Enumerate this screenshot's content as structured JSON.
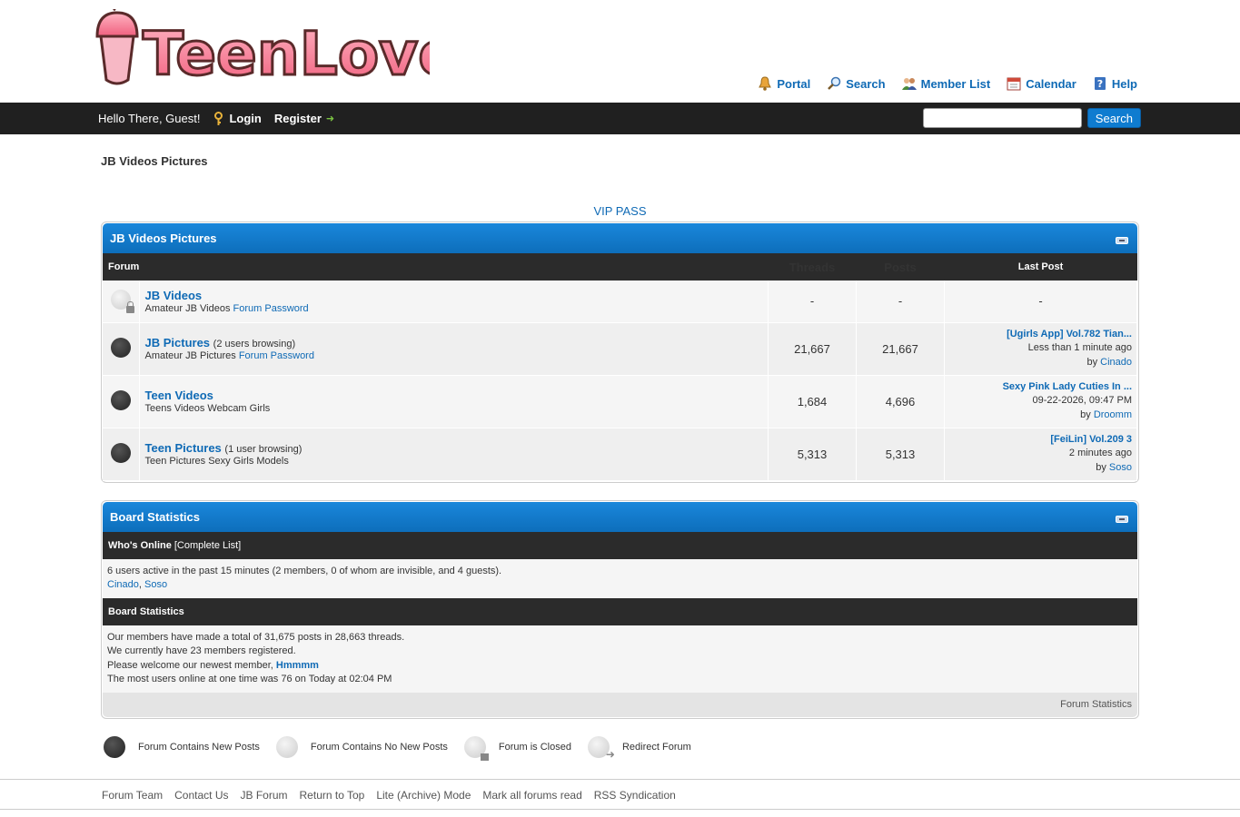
{
  "logo_text": "TeenLover",
  "toplinks": [
    {
      "label": "Portal",
      "icon": "bell-icon"
    },
    {
      "label": "Search",
      "icon": "search-icon"
    },
    {
      "label": "Member List",
      "icon": "members-icon"
    },
    {
      "label": "Calendar",
      "icon": "calendar-icon"
    },
    {
      "label": "Help",
      "icon": "help-icon"
    }
  ],
  "panel": {
    "greeting": "Hello There, Guest!",
    "login": "Login",
    "register": "Register",
    "search_button": "Search",
    "search_value": ""
  },
  "breadcrumb": "JB Videos Pictures",
  "vip": "VIP PASS",
  "category": {
    "title": "JB Videos Pictures",
    "headers": {
      "forum": "Forum",
      "threads": "Threads",
      "posts": "Posts",
      "lastpost": "Last Post"
    },
    "forums": [
      {
        "name": "JB Videos",
        "browsing": "",
        "desc": "Amateur JB Videos",
        "desc_link": "Forum Password",
        "threads": "-",
        "posts": "-",
        "last_title": "-",
        "last_time": "",
        "last_by": "",
        "last_user": "",
        "status": "closed"
      },
      {
        "name": "JB Pictures",
        "browsing": "(2 users browsing)",
        "desc": "Amateur JB Pictures",
        "desc_link": "Forum Password",
        "threads": "21,667",
        "posts": "21,667",
        "last_title": "[Ugirls App] Vol.782 Tian...",
        "last_time": "Less than 1 minute ago",
        "last_by": "by",
        "last_user": "Cinado",
        "status": "new"
      },
      {
        "name": "Teen Videos",
        "browsing": "",
        "desc": "Teens Videos Webcam Girls",
        "desc_link": "",
        "threads": "1,684",
        "posts": "4,696",
        "last_title": "Sexy Pink Lady Cuties In ...",
        "last_time": "09-22-2026, 09:47 PM",
        "last_by": "by",
        "last_user": "Droomm",
        "status": "new"
      },
      {
        "name": "Teen Pictures",
        "browsing": "(1 user browsing)",
        "desc": "Teen Pictures Sexy Girls Models",
        "desc_link": "",
        "threads": "5,313",
        "posts": "5,313",
        "last_title": "[FeiLin] Vol.209 3",
        "last_time": "2 minutes ago",
        "last_by": "by",
        "last_user": "Soso",
        "status": "new"
      }
    ]
  },
  "stats": {
    "title": "Board Statistics",
    "whos_online": "Who's Online",
    "complete_list": "[Complete List]",
    "online_line": "6 users active in the past 15 minutes (2 members, 0 of whom are invisible, and 4 guests).",
    "online_users": [
      "Cinado",
      "Soso"
    ],
    "online_sep": ",",
    "board_stats_heading": "Board Statistics",
    "line1": "Our members have made a total of 31,675 posts in 28,663 threads.",
    "line2": "We currently have 23 members registered.",
    "line3_prefix": "Please welcome our newest member,",
    "newest_member": "Hmmmm",
    "line4": "The most users online at one time was 76 on Today at 02:04 PM",
    "footer_link": "Forum Statistics"
  },
  "legend": [
    {
      "label": "Forum Contains New Posts",
      "type": "on"
    },
    {
      "label": "Forum Contains No New Posts",
      "type": "off"
    },
    {
      "label": "Forum is Closed",
      "type": "closed"
    },
    {
      "label": "Redirect Forum",
      "type": "redirect"
    }
  ],
  "footer": [
    "Forum Team",
    "Contact Us",
    "JB Forum",
    "Return to Top",
    "Lite (Archive) Mode",
    "Mark all forums read",
    "RSS Syndication"
  ],
  "colors": {
    "link": "#0f6ab5",
    "thead": "#0f7dd6",
    "panel": "#202020",
    "logo_pink": "#f47a93"
  }
}
